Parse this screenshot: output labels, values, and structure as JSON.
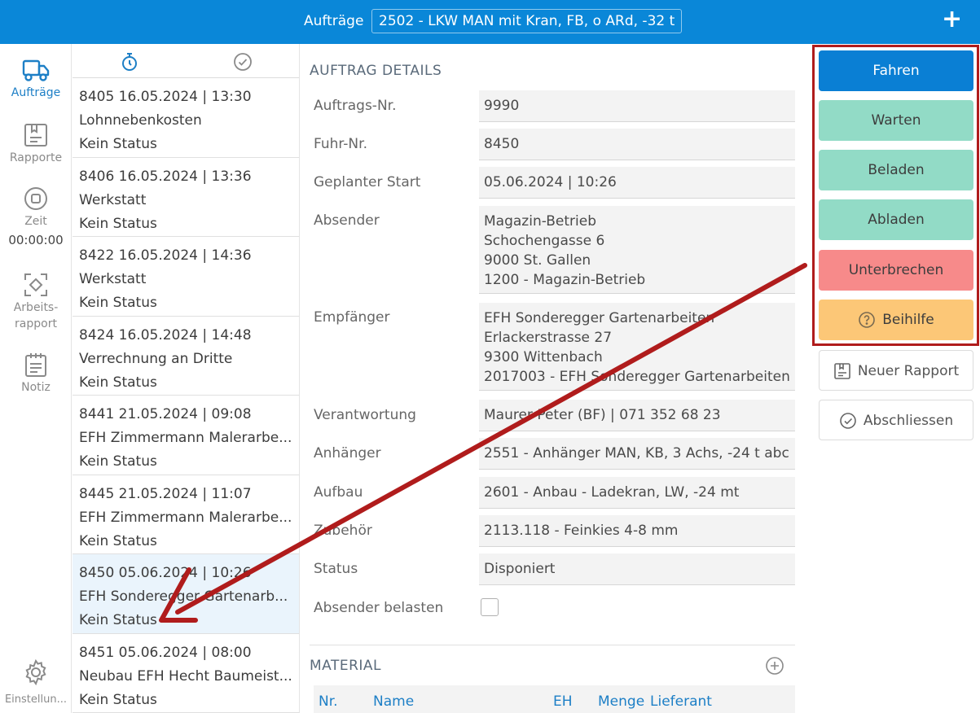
{
  "header": {
    "title": "Aufträge",
    "vehicle": "2502 - LKW MAN mit Kran, FB, o ARd, -32 t",
    "add_label": "+"
  },
  "nav": {
    "items": [
      {
        "label": "Aufträge",
        "icon": "truck-icon"
      },
      {
        "label": "Rapporte",
        "icon": "report-icon"
      },
      {
        "label": "Zeit",
        "icon": "stop-circle-icon"
      },
      {
        "label": "Arbeits-\nrapport",
        "icon": "scan-icon"
      },
      {
        "label": "Notiz",
        "icon": "notepad-icon"
      }
    ],
    "zeit_time": "00:00:00",
    "settings_label": "Einstellun..."
  },
  "list": {
    "items": [
      {
        "head": "8405  16.05.2024 | 13:30",
        "desc": "Lohnnebenkosten",
        "status": "Kein Status"
      },
      {
        "head": "8406  16.05.2024 | 13:36",
        "desc": "Werkstatt",
        "status": "Kein Status"
      },
      {
        "head": "8422  16.05.2024 | 14:36",
        "desc": "Werkstatt",
        "status": "Kein Status"
      },
      {
        "head": "8424  16.05.2024 | 14:48",
        "desc": "Verrechnung an Dritte",
        "status": "Kein Status"
      },
      {
        "head": "8441  21.05.2024 | 09:08",
        "desc": "EFH Zimmermann Malerarbe...",
        "status": "Kein Status"
      },
      {
        "head": "8445  21.05.2024 | 11:07",
        "desc": "EFH Zimmermann Malerarbe...",
        "status": "Kein Status"
      },
      {
        "head": "8450  05.06.2024 | 10:26",
        "desc": "EFH Sonderegger Gartenarb...",
        "status": "Kein Status"
      },
      {
        "head": "8451  05.06.2024 | 08:00",
        "desc": "Neubau EFH Hecht Baumeist...",
        "status": "Kein Status"
      }
    ]
  },
  "details": {
    "section_title": "AUFTRAG DETAILS",
    "auftrags_nr": {
      "label": "Auftrags-Nr.",
      "value": "9990"
    },
    "fuhr_nr": {
      "label": "Fuhr-Nr.",
      "value": "8450"
    },
    "start": {
      "label": "Geplanter Start",
      "value": "05.06.2024 | 10:26"
    },
    "absender": {
      "label": "Absender",
      "lines": [
        "Magazin-Betrieb",
        "Schochengasse 6",
        "9000 St. Gallen",
        "1200 - Magazin-Betrieb"
      ]
    },
    "empfaenger": {
      "label": "Empfänger",
      "lines": [
        "EFH Sonderegger Gartenarbeiten",
        "Erlackerstrasse 27",
        "9300 Wittenbach",
        "2017003 - EFH Sonderegger Gartenarbeiten"
      ]
    },
    "verantwortung": {
      "label": "Verantwortung",
      "value": "Maurer Peter (BF) | 071 352 68 23"
    },
    "anhaenger": {
      "label": "Anhänger",
      "value": "2551 - Anhänger MAN, KB, 3 Achs, -24 t abc"
    },
    "aufbau": {
      "label": "Aufbau",
      "value": "2601 - Anbau - Ladekran, LW, -24 mt"
    },
    "zubehoer": {
      "label": "Zubehör",
      "value": "2113.118 - Feinkies 4-8 mm"
    },
    "status": {
      "label": "Status",
      "value": "Disponiert"
    },
    "absender_belasten": {
      "label": "Absender belasten"
    }
  },
  "material": {
    "title": "MATERIAL",
    "columns": {
      "nr": "Nr.",
      "name": "Name",
      "eh": "EH",
      "menge": "Menge",
      "lieferant": "Lieferant"
    }
  },
  "actions": {
    "fahren": "Fahren",
    "warten": "Warten",
    "beladen": "Beladen",
    "abladen": "Abladen",
    "unterbrechen": "Unterbrechen",
    "beihilfe": "Beihilfe",
    "neuer_rapport": "Neuer Rapport",
    "abschliessen": "Abschliessen"
  },
  "colors": {
    "primary": "#0a87d8",
    "green": "#92dbc6",
    "red": "#f78a8a",
    "orange": "#fcc777",
    "annotation": "#b01c1c"
  }
}
